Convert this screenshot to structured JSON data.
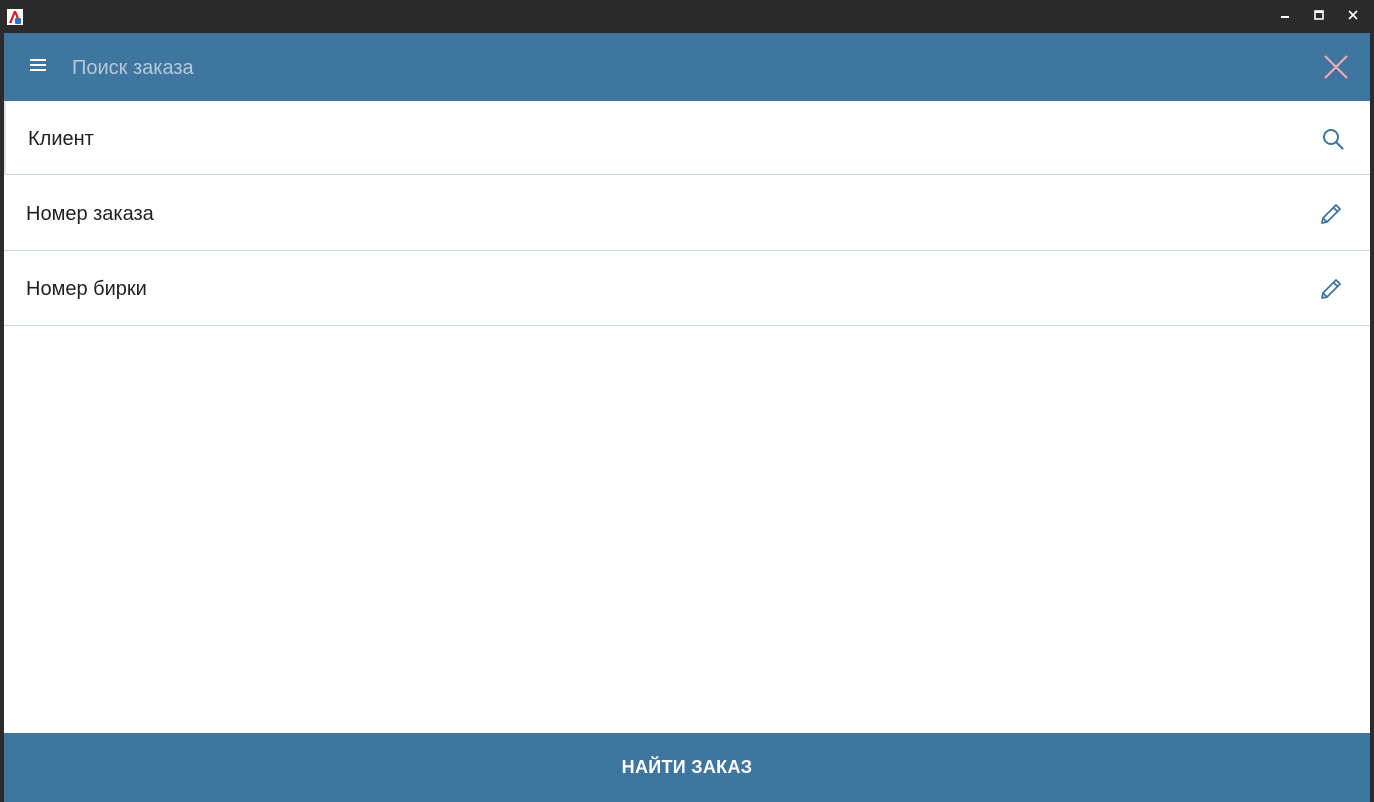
{
  "window": {
    "icon": "app-logo-icon",
    "controls": {
      "minimize_icon": "minimize-icon",
      "maximize_icon": "maximize-icon",
      "close_icon": "close-icon"
    }
  },
  "appbar": {
    "menu_icon": "hamburger-menu-icon",
    "search_placeholder": "Поиск заказа",
    "search_value": "",
    "close_icon": "close-icon"
  },
  "fields": [
    {
      "label": "Клиент",
      "icon": "search-icon"
    },
    {
      "label": "Номер заказа",
      "icon": "pencil-icon"
    },
    {
      "label": "Номер бирки",
      "icon": "pencil-icon"
    }
  ],
  "footer": {
    "find_label": "НАЙТИ ЗАКАЗ"
  },
  "colors": {
    "accent": "#3f769f",
    "titlebar": "#2b2b2b",
    "divider": "#c7d6df",
    "close_accent": "#f2a7b8"
  }
}
